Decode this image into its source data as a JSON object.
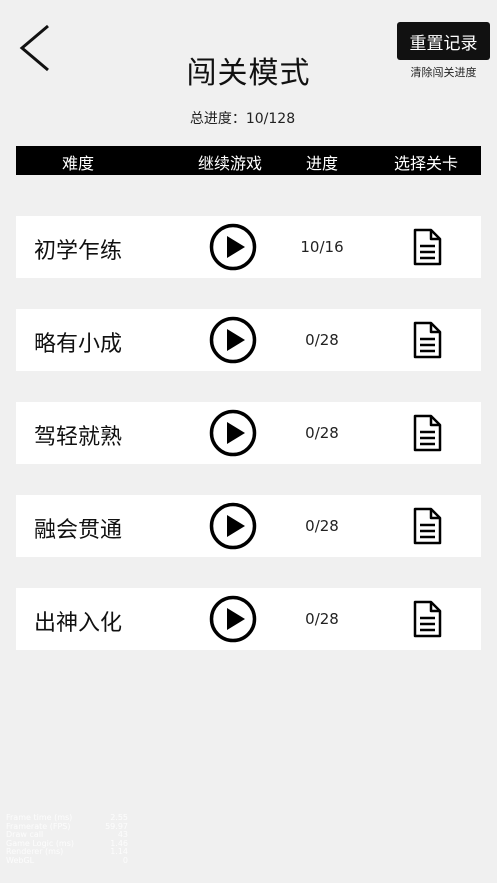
{
  "header": {
    "back_icon": "chevron-left-icon",
    "title": "闯关模式",
    "reset_button_label": "重置记录",
    "reset_subtitle": "清除闯关进度"
  },
  "total_progress": "总进度：10/128",
  "table_header": {
    "difficulty": "难度",
    "continue": "继续游戏",
    "progress": "进度",
    "select_level": "选择关卡"
  },
  "levels": [
    {
      "name": "初学乍练",
      "progress": "10/16"
    },
    {
      "name": "略有小成",
      "progress": "0/28"
    },
    {
      "name": "驾轻就熟",
      "progress": "0/28"
    },
    {
      "name": "融会贯通",
      "progress": "0/28"
    },
    {
      "name": "出神入化",
      "progress": "0/28"
    }
  ],
  "icons": {
    "play": "play-circle-icon",
    "select": "document-icon"
  },
  "debug_stats": [
    {
      "label": "Frame time (ms)",
      "value": "2.55"
    },
    {
      "label": "Framerate (FPS)",
      "value": "59.97"
    },
    {
      "label": "Draw call",
      "value": "43"
    },
    {
      "label": "Game Logic (ms)",
      "value": "1.46"
    },
    {
      "label": "Renderer (ms)",
      "value": "1.14"
    },
    {
      "label": "WebGL",
      "value": "0"
    }
  ],
  "colors": {
    "background": "#f0f0f0",
    "header_bar": "#000000",
    "row": "#ffffff"
  }
}
